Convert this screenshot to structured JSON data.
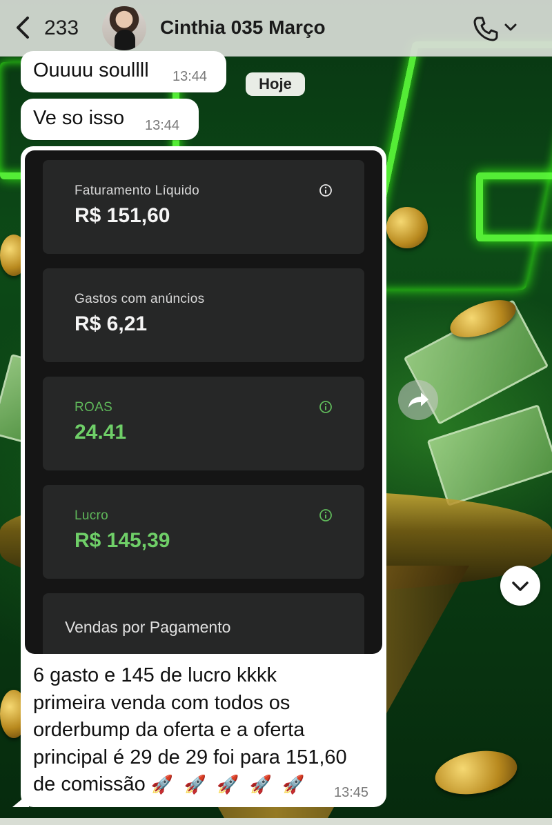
{
  "header": {
    "back_count": "233",
    "contact_name": "Cinthia 035 Março"
  },
  "date_chip": "Hoje",
  "messages": [
    {
      "text": "Ouuuu soullll",
      "time": "13:44"
    },
    {
      "text": "Ve so isso",
      "time": "13:44"
    }
  ],
  "screenshot": {
    "cards": [
      {
        "label": "Faturamento Líquido",
        "value": "R$ 151,60",
        "has_info_icon": true,
        "accent": "white"
      },
      {
        "label": "Gastos com anúncios",
        "value": "R$ 6,21",
        "has_info_icon": false,
        "accent": "white"
      },
      {
        "label": "ROAS",
        "value": "24.41",
        "has_info_icon": true,
        "accent": "green"
      },
      {
        "label": "Lucro",
        "value": "R$ 145,39",
        "has_info_icon": true,
        "accent": "green"
      }
    ],
    "last_card_title": "Vendas por Pagamento"
  },
  "caption": {
    "lines": [
      "6 gasto e 145 de lucro kkkk",
      "primeira venda com todos os",
      "orderbump da oferta e a oferta",
      "principal é 29 de 29 foi para 151,60",
      "de comissão"
    ],
    "emoji": "🚀 🚀 🚀 🚀 🚀",
    "time": "13:45"
  },
  "colors": {
    "header_bg": "#d7dbd5",
    "bubble_bg": "#ffffff",
    "card_bg": "#262727",
    "accent_green": "#6fcf68"
  },
  "icons": [
    "chevron-left-icon",
    "phone-icon",
    "chevron-down-icon",
    "info-icon",
    "forward-icon",
    "scroll-down-icon"
  ]
}
